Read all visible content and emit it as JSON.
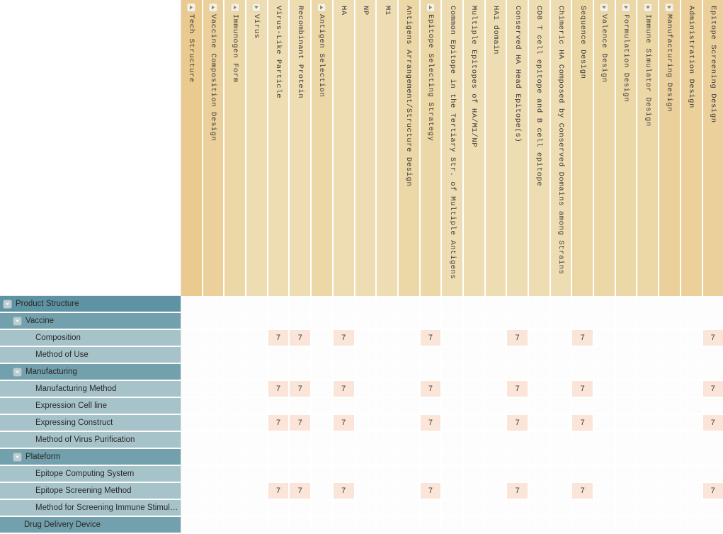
{
  "view": {
    "type": "patent-technology-matrix",
    "row_header_width": 256,
    "colors": {
      "row_level0": "#5d93a2",
      "row_level1": "#72a0ac",
      "row_level2": "#a7c3ca",
      "col_level0": "#eaca8e",
      "col_level1": "#ebd09b",
      "col_level2": "#ecd7a7",
      "col_level3": "#eedcb2",
      "cell_filled_bg": "#fae5d8",
      "cell_empty_bg": "#fdfdfd",
      "grid_line": "#ffffff"
    }
  },
  "columns": [
    {
      "label": "Tech Structure",
      "level": 0,
      "toggle": "collapsed",
      "icon": "triangle-right-icon"
    },
    {
      "label": "Vaccine Composition Design",
      "level": 1,
      "toggle": "collapsed",
      "icon": "triangle-right-icon"
    },
    {
      "label": "Immunogen Form",
      "level": 2,
      "toggle": "collapsed",
      "icon": "triangle-right-icon"
    },
    {
      "label": "Virus",
      "level": 3,
      "toggle": "expanded",
      "icon": "triangle-down-icon"
    },
    {
      "label": "Virus-Like Particle",
      "level": 3,
      "toggle": "none",
      "icon": ""
    },
    {
      "label": "Recombinant Protein",
      "level": 3,
      "toggle": "none",
      "icon": ""
    },
    {
      "label": "Antigen Selection",
      "level": 2,
      "toggle": "collapsed",
      "icon": "triangle-right-icon"
    },
    {
      "label": "HA",
      "level": 3,
      "toggle": "none",
      "icon": ""
    },
    {
      "label": "NP",
      "level": 3,
      "toggle": "none",
      "icon": ""
    },
    {
      "label": "M1",
      "level": 3,
      "toggle": "none",
      "icon": ""
    },
    {
      "label": "Antigens Arrangement/Structure Design",
      "level": 2,
      "toggle": "none",
      "icon": ""
    },
    {
      "label": "Epitope Selecting Strategy",
      "level": 2,
      "toggle": "collapsed",
      "icon": "triangle-right-icon"
    },
    {
      "label": "Common Epitope in the Tertiary Str. of Multiple Antigens",
      "level": 3,
      "toggle": "none",
      "icon": ""
    },
    {
      "label": "Multiple Epitopes of HA/M1/NP",
      "level": 3,
      "toggle": "none",
      "icon": ""
    },
    {
      "label": "HA1 domain",
      "level": 3,
      "toggle": "none",
      "icon": ""
    },
    {
      "label": "Conserved HA Head Epitope(s)",
      "level": 3,
      "toggle": "none",
      "icon": ""
    },
    {
      "label": "CD8 T cell epitope and B cell epitope",
      "level": 3,
      "toggle": "none",
      "icon": ""
    },
    {
      "label": "Chimeric HA Composed by Conserved Domains among Strains",
      "level": 3,
      "toggle": "none",
      "icon": ""
    },
    {
      "label": "Sequence Design",
      "level": 2,
      "toggle": "none",
      "icon": ""
    },
    {
      "label": "Valence Design",
      "level": 2,
      "toggle": "expanded",
      "icon": "triangle-down-icon"
    },
    {
      "label": "Formulation Design",
      "level": 2,
      "toggle": "expanded",
      "icon": "triangle-down-icon"
    },
    {
      "label": "Immune Simulator Design",
      "level": 2,
      "toggle": "expanded",
      "icon": "triangle-down-icon"
    },
    {
      "label": "Manufacturing Design",
      "level": 1,
      "toggle": "expanded",
      "icon": "triangle-down-icon"
    },
    {
      "label": "Administration Design",
      "level": 1,
      "toggle": "none",
      "icon": ""
    },
    {
      "label": "Epitope Screening Design",
      "level": 1,
      "toggle": "none",
      "icon": ""
    }
  ],
  "rows": [
    {
      "label": "Product Structure",
      "level": 0,
      "toggle": "expanded",
      "icon": "triangle-down-icon",
      "cells": [
        "",
        "",
        "",
        "",
        "",
        "",
        "",
        "",
        "",
        "",
        "",
        "",
        "",
        "",
        "",
        "",
        "",
        "",
        "",
        "",
        "",
        "",
        "",
        "",
        ""
      ]
    },
    {
      "label": "Vaccine",
      "level": 1,
      "toggle": "expanded",
      "icon": "triangle-down-icon",
      "cells": [
        "",
        "",
        "",
        "",
        "",
        "",
        "",
        "",
        "",
        "",
        "",
        "",
        "",
        "",
        "",
        "",
        "",
        "",
        "",
        "",
        "",
        "",
        "",
        "",
        ""
      ]
    },
    {
      "label": "Composition",
      "level": 2,
      "toggle": "none",
      "icon": "",
      "cells": [
        "",
        "",
        "",
        "",
        "7",
        "7",
        "",
        "7",
        "",
        "",
        "",
        "7",
        "",
        "",
        "",
        "7",
        "",
        "",
        "7",
        "",
        "",
        "",
        "",
        "",
        "7"
      ]
    },
    {
      "label": "Method of Use",
      "level": 2,
      "toggle": "none",
      "icon": "",
      "cells": [
        "",
        "",
        "",
        "",
        "",
        "",
        "",
        "",
        "",
        "",
        "",
        "",
        "",
        "",
        "",
        "",
        "",
        "",
        "",
        "",
        "",
        "",
        "",
        "",
        ""
      ]
    },
    {
      "label": "Manufacturing",
      "level": 1,
      "toggle": "expanded",
      "icon": "triangle-down-icon",
      "cells": [
        "",
        "",
        "",
        "",
        "",
        "",
        "",
        "",
        "",
        "",
        "",
        "",
        "",
        "",
        "",
        "",
        "",
        "",
        "",
        "",
        "",
        "",
        "",
        "",
        ""
      ]
    },
    {
      "label": "Manufacturing Method",
      "level": 2,
      "toggle": "none",
      "icon": "",
      "cells": [
        "",
        "",
        "",
        "",
        "7",
        "7",
        "",
        "7",
        "",
        "",
        "",
        "7",
        "",
        "",
        "",
        "7",
        "",
        "",
        "7",
        "",
        "",
        "",
        "",
        "",
        "7"
      ]
    },
    {
      "label": "Expression Cell line",
      "level": 2,
      "toggle": "none",
      "icon": "",
      "cells": [
        "",
        "",
        "",
        "",
        "",
        "",
        "",
        "",
        "",
        "",
        "",
        "",
        "",
        "",
        "",
        "",
        "",
        "",
        "",
        "",
        "",
        "",
        "",
        "",
        ""
      ]
    },
    {
      "label": "Expressing Construct",
      "level": 2,
      "toggle": "none",
      "icon": "",
      "cells": [
        "",
        "",
        "",
        "",
        "7",
        "7",
        "",
        "7",
        "",
        "",
        "",
        "7",
        "",
        "",
        "",
        "7",
        "",
        "",
        "7",
        "",
        "",
        "",
        "",
        "",
        "7"
      ]
    },
    {
      "label": "Method of Virus Purification",
      "level": 2,
      "toggle": "none",
      "icon": "",
      "cells": [
        "",
        "",
        "",
        "",
        "",
        "",
        "",
        "",
        "",
        "",
        "",
        "",
        "",
        "",
        "",
        "",
        "",
        "",
        "",
        "",
        "",
        "",
        "",
        "",
        ""
      ]
    },
    {
      "label": "Plateform",
      "level": 1,
      "toggle": "expanded",
      "icon": "triangle-down-icon",
      "cells": [
        "",
        "",
        "",
        "",
        "",
        "",
        "",
        "",
        "",
        "",
        "",
        "",
        "",
        "",
        "",
        "",
        "",
        "",
        "",
        "",
        "",
        "",
        "",
        "",
        ""
      ]
    },
    {
      "label": "Epitope Computing System",
      "level": 2,
      "toggle": "none",
      "icon": "",
      "cells": [
        "",
        "",
        "",
        "",
        "",
        "",
        "",
        "",
        "",
        "",
        "",
        "",
        "",
        "",
        "",
        "",
        "",
        "",
        "",
        "",
        "",
        "",
        "",
        "",
        ""
      ]
    },
    {
      "label": "Epitope Screening Method",
      "level": 2,
      "toggle": "none",
      "icon": "",
      "cells": [
        "",
        "",
        "",
        "",
        "7",
        "7",
        "",
        "7",
        "",
        "",
        "",
        "7",
        "",
        "",
        "",
        "7",
        "",
        "",
        "7",
        "",
        "",
        "",
        "",
        "",
        "7"
      ]
    },
    {
      "label": "Method for Screening Immune Stimulator",
      "level": 2,
      "toggle": "none",
      "icon": "",
      "cells": [
        "",
        "",
        "",
        "",
        "",
        "",
        "",
        "",
        "",
        "",
        "",
        "",
        "",
        "",
        "",
        "",
        "",
        "",
        "",
        "",
        "",
        "",
        "",
        "",
        ""
      ]
    },
    {
      "label": "Drug Delivery Device",
      "level": 1,
      "toggle": "none",
      "icon": "",
      "cells": [
        "",
        "",
        "",
        "",
        "",
        "",
        "",
        "",
        "",
        "",
        "",
        "",
        "",
        "",
        "",
        "",
        "",
        "",
        "",
        "",
        "",
        "",
        "",
        "",
        ""
      ]
    }
  ]
}
